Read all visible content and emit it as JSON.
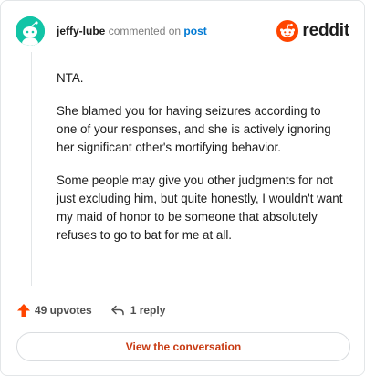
{
  "comment": {
    "username": "jeffy-lube",
    "verb": "commented on",
    "target": "post",
    "paragraphs": [
      "NTA.",
      "She blamed you for having seizures according to one of your responses, and she is actively ignoring her significant other's mortifying behavior.",
      "Some people may give you other judgments for not just excluding him, but quite honestly, I wouldn't want my maid of honor to be someone that absolutely refuses to go to bat for me at all."
    ]
  },
  "brand": {
    "wordmark": "reddit",
    "icon": "reddit-snoo-icon",
    "color": "#ff4500"
  },
  "actions": {
    "upvotes_label": "49 upvotes",
    "replies_label": "1 reply",
    "upvote_icon": "upvote-arrow-icon",
    "reply_icon": "reply-arrow-icon"
  },
  "cta": {
    "label": "View the conversation"
  },
  "colors": {
    "avatar": "#12c4a6",
    "link": "#0079d3",
    "upvote": "#ff4500",
    "cta_text": "#c83a12"
  }
}
